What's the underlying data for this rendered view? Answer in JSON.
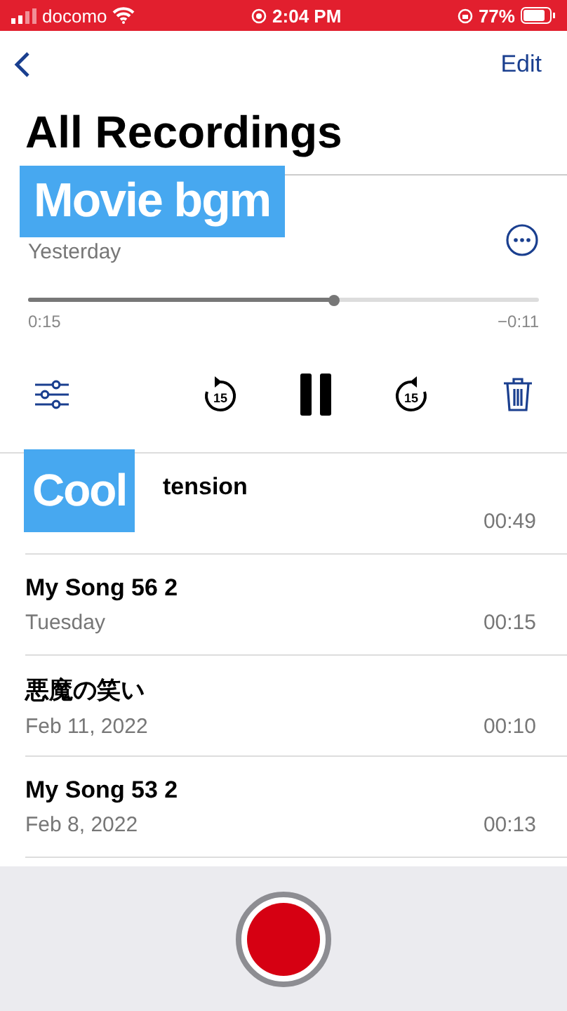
{
  "status_bar": {
    "carrier": "docomo",
    "time": "2:04 PM",
    "battery": "77%"
  },
  "nav": {
    "edit": "Edit"
  },
  "title": "All Recordings",
  "current": {
    "date": "Yesterday",
    "level": 0.6,
    "elapsed": "0:15",
    "remaining": "−0:11",
    "playing": true,
    "skip_back": "15",
    "skip_forward": "15"
  },
  "recordings": [
    {
      "name": "tension",
      "duration": "00:49"
    },
    {
      "name": "My Song 56 2",
      "date": "Tuesday",
      "duration": "00:15"
    },
    {
      "name": "悪魔の笑い",
      "date": "Feb 11, 2022",
      "duration": "00:10"
    },
    {
      "name": "My Song 53 2",
      "date": "Feb 8, 2022",
      "duration": "00:13"
    }
  ],
  "captions": [
    {
      "text": "Movie bgm",
      "kind": "big"
    },
    {
      "text": "Cool",
      "kind": "small"
    }
  ]
}
